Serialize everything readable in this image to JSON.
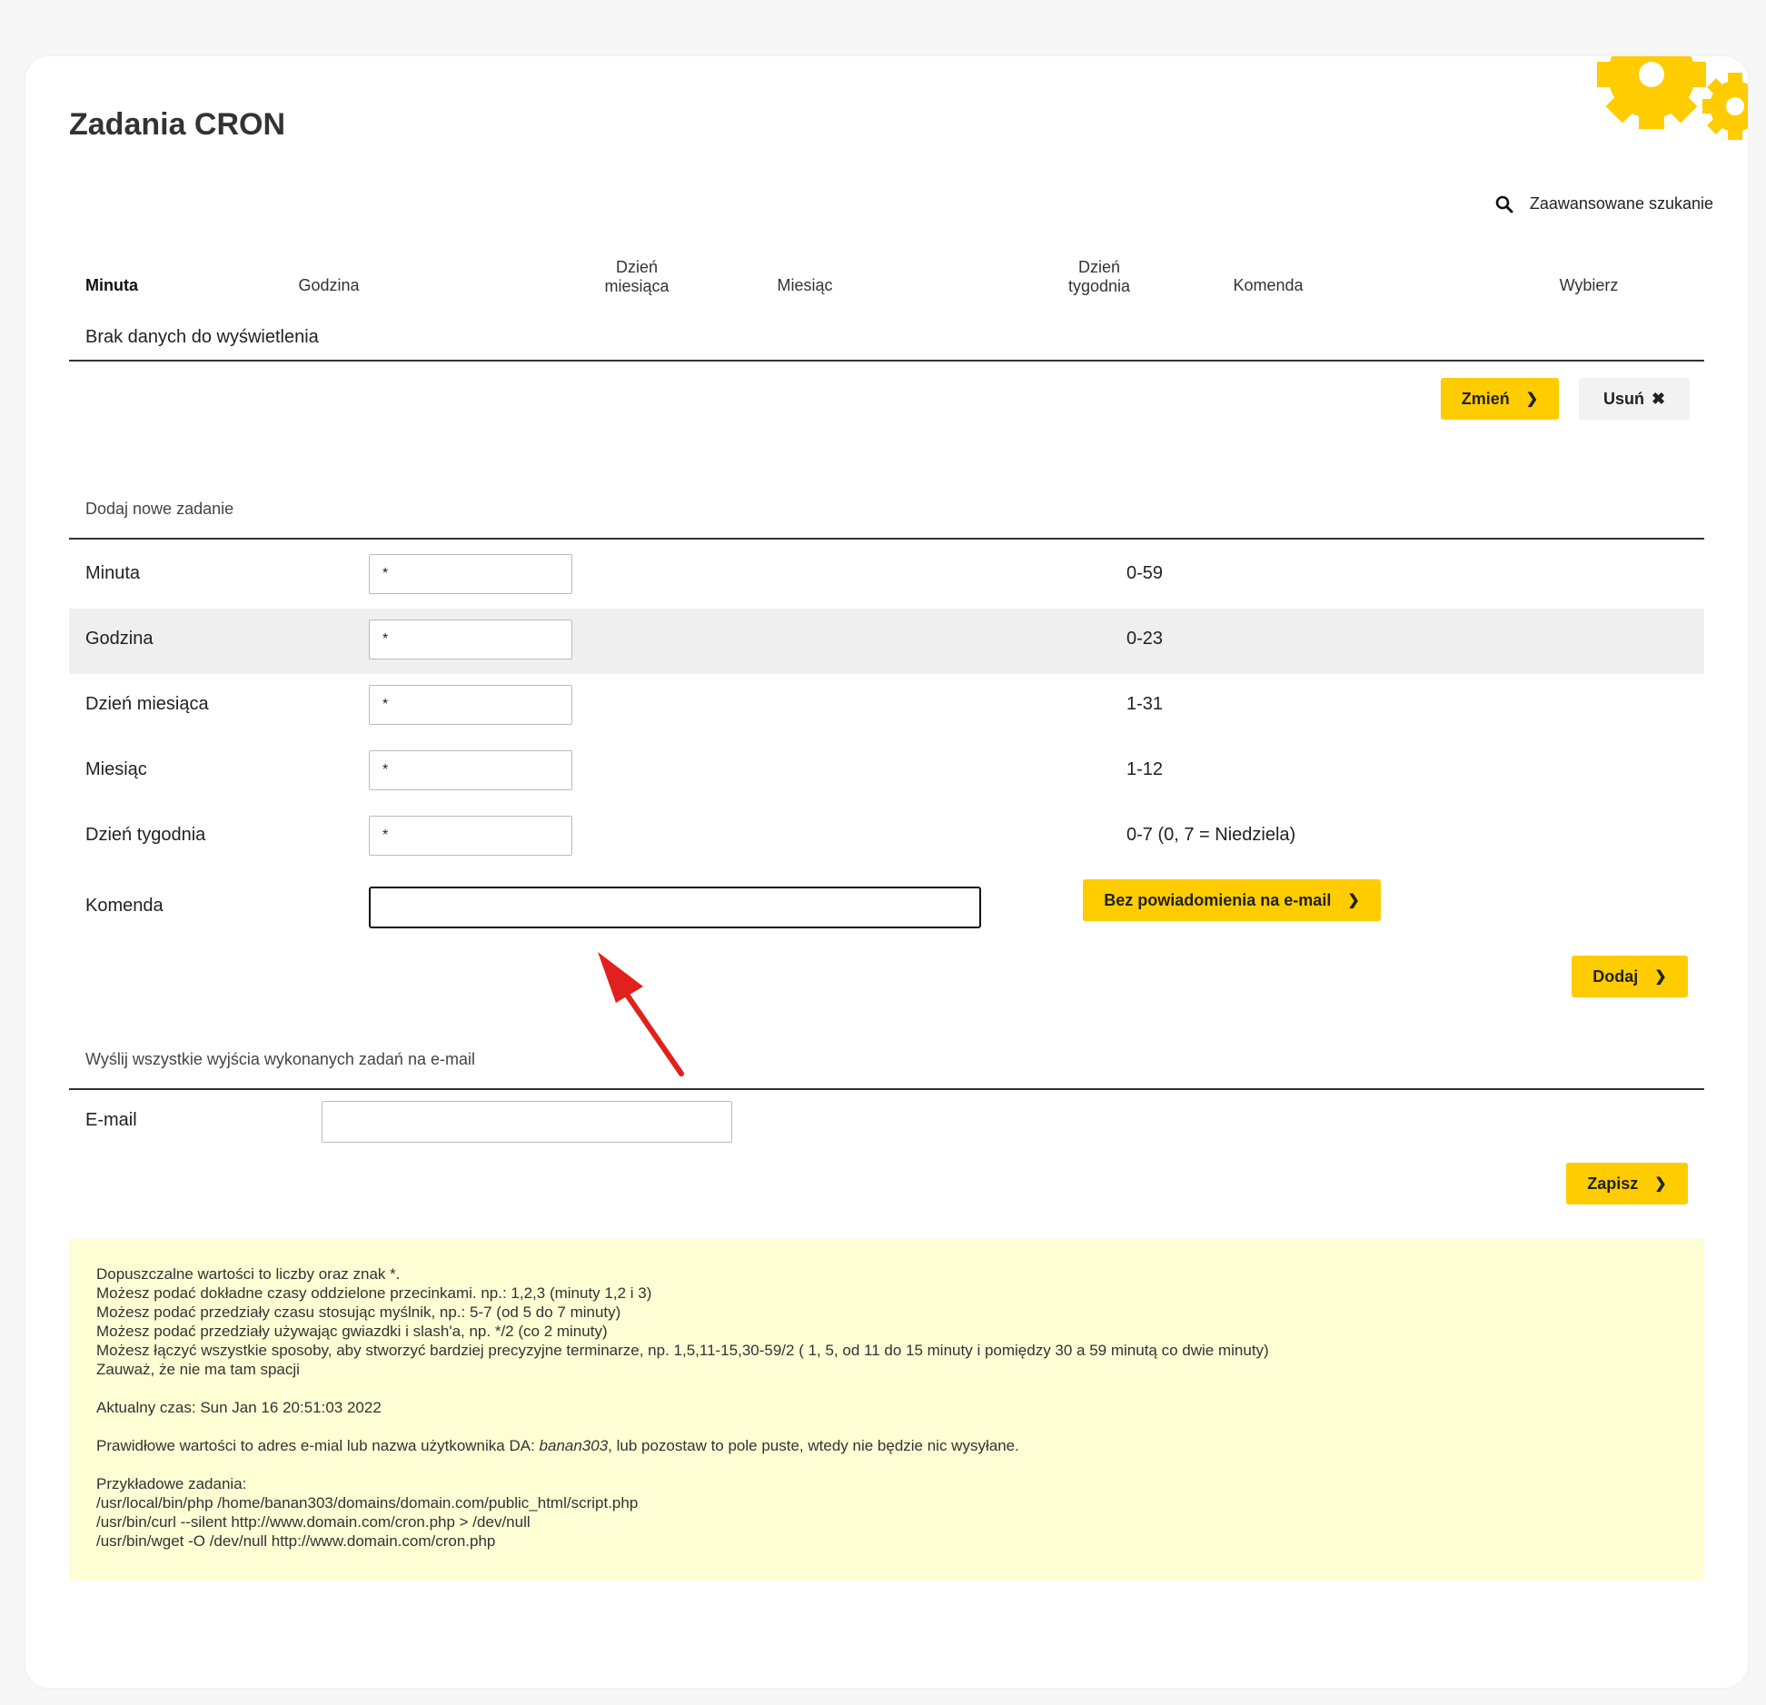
{
  "page": {
    "title": "Zadania CRON"
  },
  "search": {
    "advanced_label": "Zaawansowane szukanie"
  },
  "table": {
    "headers": {
      "minute": "Minuta",
      "hour": "Godzina",
      "day_of_month_1": "Dzień",
      "day_of_month_2": "miesiąca",
      "month": "Miesiąc",
      "day_of_week_1": "Dzień",
      "day_of_week_2": "tygodnia",
      "command": "Komenda",
      "select": "Wybierz"
    },
    "empty_message": "Brak danych do wyświetlenia",
    "change_button": "Zmień",
    "delete_button": "Usuń"
  },
  "add_form": {
    "section_title": "Dodaj nowe zadanie",
    "rows": [
      {
        "label": "Minuta",
        "value": "*",
        "range": "0-59"
      },
      {
        "label": "Godzina",
        "value": "*",
        "range": "0-23"
      },
      {
        "label": "Dzień miesiąca",
        "value": "*",
        "range": "1-31"
      },
      {
        "label": "Miesiąc",
        "value": "*",
        "range": "1-12"
      },
      {
        "label": "Dzień tygodnia",
        "value": "*",
        "range": "0-7 (0, 7 = Niedziela)"
      }
    ],
    "command_label": "Komenda",
    "command_value": "",
    "no_email_button": "Bez powiadomienia na e-mail",
    "add_button": "Dodaj"
  },
  "email_section": {
    "title": "Wyślij wszystkie wyjścia wykonanych zadań na e-mail",
    "email_label": "E-mail",
    "email_value": "",
    "save_button": "Zapisz"
  },
  "info": {
    "lines": [
      "Dopuszczalne wartości to liczby oraz znak *.",
      "Możesz podać dokładne czasy oddzielone przecinkami. np.: 1,2,3 (minuty 1,2 i 3)",
      "Możesz podać przedziały czasu stosując myślnik, np.: 5-7 (od 5 do 7 minuty)",
      "Możesz podać przedziały używając gwiazdki i slash'a, np. */2 (co 2 minuty)",
      "Możesz łączyć wszystkie sposoby, aby stworzyć bardziej precyzyjne terminarze, np. 1,5,11-15,30-59/2 ( 1, 5, od 11 do 15 minuty i pomiędzy 30 a 59 minutą co dwie minuty)",
      "Zauważ, że nie ma tam spacji"
    ],
    "current_time": "Aktualny czas: Sun Jan 16 20:51:03 2022",
    "email_note_prefix": "Prawidłowe wartości to adres e-mial lub nazwa użytkownika DA: ",
    "username": "banan303",
    "email_note_suffix": ", lub pozostaw to pole puste, wtedy nie będzie nic wysyłane.",
    "examples_title": "Przykładowe zadania:",
    "examples": [
      "/usr/local/bin/php /home/banan303/domains/domain.com/public_html/script.php",
      "/usr/bin/curl --silent http://www.domain.com/cron.php > /dev/null",
      "/usr/bin/wget -O /dev/null http://www.domain.com/cron.php"
    ]
  },
  "colors": {
    "accent": "#ffcc00",
    "info_bg": "#fdfed4",
    "annotation_arrow": "#e0211d"
  }
}
